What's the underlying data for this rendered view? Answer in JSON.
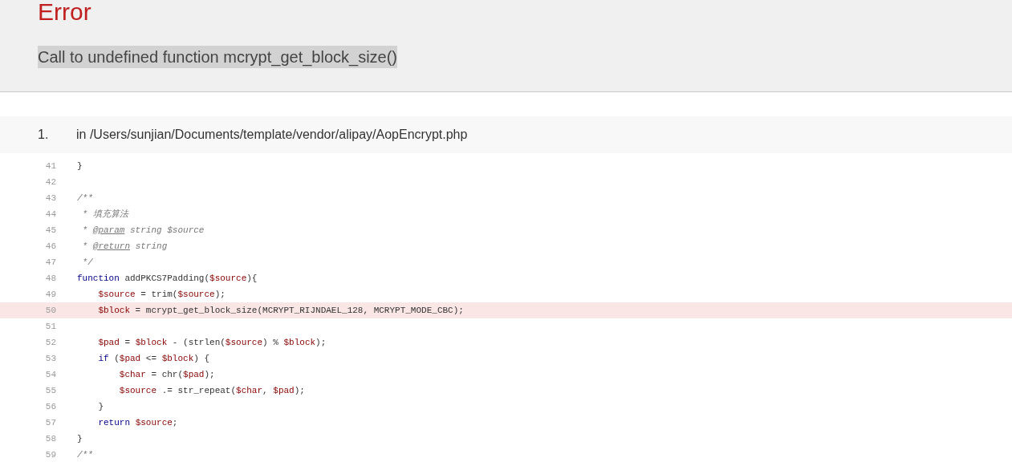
{
  "error": {
    "title": "Error",
    "message": "Call to undefined function mcrypt_get_block_size()"
  },
  "trace": [
    {
      "number": "1.",
      "location": "in /Users/sunjian/Documents/template/vendor/alipay/AopEncrypt.php"
    }
  ],
  "code": [
    {
      "line": "41",
      "text": "}",
      "kind": "code",
      "highlighted": false
    },
    {
      "line": "42",
      "highlighted": false
    },
    {
      "line": "43",
      "text": "/**",
      "kind": "comment",
      "highlighted": false
    },
    {
      "line": "44",
      "text": " * 填充算法",
      "kind": "comment",
      "highlighted": false
    },
    {
      "line": "45",
      "text": " * @param string $source",
      "kind": "comment",
      "highlighted": false
    },
    {
      "line": "46",
      "text": " * @return string",
      "kind": "comment",
      "highlighted": false
    },
    {
      "line": "47",
      "text": " */",
      "kind": "comment",
      "highlighted": false
    },
    {
      "line": "48",
      "text": "function addPKCS7Padding($source){",
      "kind": "code",
      "highlighted": false
    },
    {
      "line": "49",
      "text": "    $source = trim($source);",
      "kind": "code",
      "highlighted": false
    },
    {
      "line": "50",
      "text": "    $block = mcrypt_get_block_size(MCRYPT_RIJNDAEL_128, MCRYPT_MODE_CBC);",
      "kind": "code",
      "highlighted": true
    },
    {
      "line": "51",
      "highlighted": false
    },
    {
      "line": "52",
      "text": "    $pad = $block - (strlen($source) % $block);",
      "kind": "code",
      "highlighted": false
    },
    {
      "line": "53",
      "text": "    if ($pad <= $block) {",
      "kind": "code",
      "highlighted": false
    },
    {
      "line": "54",
      "text": "        $char = chr($pad);",
      "kind": "code",
      "highlighted": false
    },
    {
      "line": "55",
      "text": "        $source .= str_repeat($char, $pad);",
      "kind": "code",
      "highlighted": false
    },
    {
      "line": "56",
      "text": "    }",
      "kind": "code",
      "highlighted": false
    },
    {
      "line": "57",
      "text": "    return $source;",
      "kind": "code",
      "highlighted": false
    },
    {
      "line": "58",
      "text": "}",
      "kind": "code",
      "highlighted": false
    },
    {
      "line": "59",
      "text": "/**",
      "kind": "comment",
      "highlighted": false
    }
  ]
}
